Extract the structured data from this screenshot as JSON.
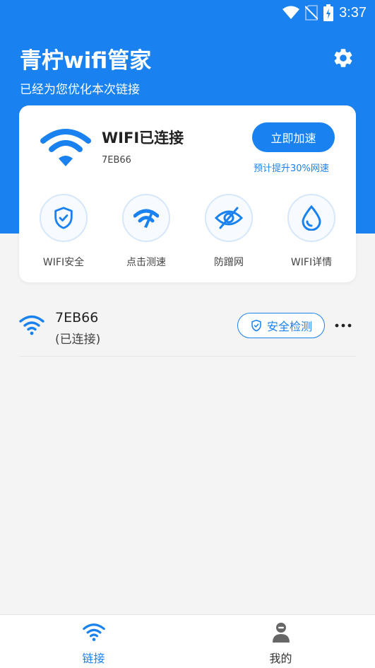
{
  "status_bar": {
    "time": "3:37",
    "icons": [
      "wifi-signal-icon",
      "no-sim-icon",
      "battery-charging-icon"
    ]
  },
  "header": {
    "title": "青柠wifi管家",
    "subtitle": "已经为您优化本次链接",
    "settings_icon": "gear-icon"
  },
  "connection_card": {
    "title": "WIFI已连接",
    "ssid": "7EB66",
    "boost_button": "立即加速",
    "boost_tip": "预计提升30%网速",
    "features": [
      {
        "label": "WIFI安全",
        "icon": "shield-check-icon"
      },
      {
        "label": "点击测速",
        "icon": "speedometer-icon"
      },
      {
        "label": "防蹭网",
        "icon": "eye-off-icon"
      },
      {
        "label": "WIFI详情",
        "icon": "water-drop-icon"
      }
    ]
  },
  "wifi_list": [
    {
      "ssid": "7EB66",
      "status": "(已连接)",
      "action": "安全检测",
      "more": "more-icon"
    }
  ],
  "bottom_nav": [
    {
      "label": "链接",
      "icon": "wifi-icon",
      "active": true
    },
    {
      "label": "我的",
      "icon": "user-icon",
      "active": false
    }
  ],
  "colors": {
    "primary": "#1a82f0",
    "background": "#f4f4f4",
    "nav_inactive": "#333333"
  }
}
